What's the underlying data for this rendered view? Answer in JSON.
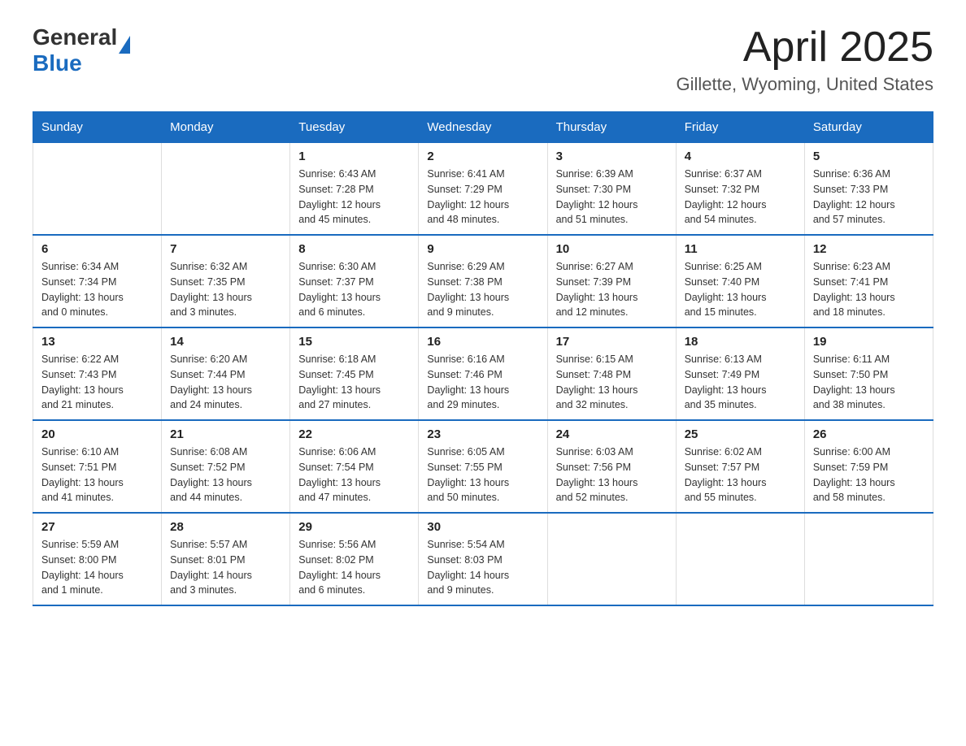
{
  "logo": {
    "general": "General",
    "blue": "Blue"
  },
  "title": "April 2025",
  "location": "Gillette, Wyoming, United States",
  "days_of_week": [
    "Sunday",
    "Monday",
    "Tuesday",
    "Wednesday",
    "Thursday",
    "Friday",
    "Saturday"
  ],
  "weeks": [
    [
      {
        "day": "",
        "info": ""
      },
      {
        "day": "",
        "info": ""
      },
      {
        "day": "1",
        "info": "Sunrise: 6:43 AM\nSunset: 7:28 PM\nDaylight: 12 hours\nand 45 minutes."
      },
      {
        "day": "2",
        "info": "Sunrise: 6:41 AM\nSunset: 7:29 PM\nDaylight: 12 hours\nand 48 minutes."
      },
      {
        "day": "3",
        "info": "Sunrise: 6:39 AM\nSunset: 7:30 PM\nDaylight: 12 hours\nand 51 minutes."
      },
      {
        "day": "4",
        "info": "Sunrise: 6:37 AM\nSunset: 7:32 PM\nDaylight: 12 hours\nand 54 minutes."
      },
      {
        "day": "5",
        "info": "Sunrise: 6:36 AM\nSunset: 7:33 PM\nDaylight: 12 hours\nand 57 minutes."
      }
    ],
    [
      {
        "day": "6",
        "info": "Sunrise: 6:34 AM\nSunset: 7:34 PM\nDaylight: 13 hours\nand 0 minutes."
      },
      {
        "day": "7",
        "info": "Sunrise: 6:32 AM\nSunset: 7:35 PM\nDaylight: 13 hours\nand 3 minutes."
      },
      {
        "day": "8",
        "info": "Sunrise: 6:30 AM\nSunset: 7:37 PM\nDaylight: 13 hours\nand 6 minutes."
      },
      {
        "day": "9",
        "info": "Sunrise: 6:29 AM\nSunset: 7:38 PM\nDaylight: 13 hours\nand 9 minutes."
      },
      {
        "day": "10",
        "info": "Sunrise: 6:27 AM\nSunset: 7:39 PM\nDaylight: 13 hours\nand 12 minutes."
      },
      {
        "day": "11",
        "info": "Sunrise: 6:25 AM\nSunset: 7:40 PM\nDaylight: 13 hours\nand 15 minutes."
      },
      {
        "day": "12",
        "info": "Sunrise: 6:23 AM\nSunset: 7:41 PM\nDaylight: 13 hours\nand 18 minutes."
      }
    ],
    [
      {
        "day": "13",
        "info": "Sunrise: 6:22 AM\nSunset: 7:43 PM\nDaylight: 13 hours\nand 21 minutes."
      },
      {
        "day": "14",
        "info": "Sunrise: 6:20 AM\nSunset: 7:44 PM\nDaylight: 13 hours\nand 24 minutes."
      },
      {
        "day": "15",
        "info": "Sunrise: 6:18 AM\nSunset: 7:45 PM\nDaylight: 13 hours\nand 27 minutes."
      },
      {
        "day": "16",
        "info": "Sunrise: 6:16 AM\nSunset: 7:46 PM\nDaylight: 13 hours\nand 29 minutes."
      },
      {
        "day": "17",
        "info": "Sunrise: 6:15 AM\nSunset: 7:48 PM\nDaylight: 13 hours\nand 32 minutes."
      },
      {
        "day": "18",
        "info": "Sunrise: 6:13 AM\nSunset: 7:49 PM\nDaylight: 13 hours\nand 35 minutes."
      },
      {
        "day": "19",
        "info": "Sunrise: 6:11 AM\nSunset: 7:50 PM\nDaylight: 13 hours\nand 38 minutes."
      }
    ],
    [
      {
        "day": "20",
        "info": "Sunrise: 6:10 AM\nSunset: 7:51 PM\nDaylight: 13 hours\nand 41 minutes."
      },
      {
        "day": "21",
        "info": "Sunrise: 6:08 AM\nSunset: 7:52 PM\nDaylight: 13 hours\nand 44 minutes."
      },
      {
        "day": "22",
        "info": "Sunrise: 6:06 AM\nSunset: 7:54 PM\nDaylight: 13 hours\nand 47 minutes."
      },
      {
        "day": "23",
        "info": "Sunrise: 6:05 AM\nSunset: 7:55 PM\nDaylight: 13 hours\nand 50 minutes."
      },
      {
        "day": "24",
        "info": "Sunrise: 6:03 AM\nSunset: 7:56 PM\nDaylight: 13 hours\nand 52 minutes."
      },
      {
        "day": "25",
        "info": "Sunrise: 6:02 AM\nSunset: 7:57 PM\nDaylight: 13 hours\nand 55 minutes."
      },
      {
        "day": "26",
        "info": "Sunrise: 6:00 AM\nSunset: 7:59 PM\nDaylight: 13 hours\nand 58 minutes."
      }
    ],
    [
      {
        "day": "27",
        "info": "Sunrise: 5:59 AM\nSunset: 8:00 PM\nDaylight: 14 hours\nand 1 minute."
      },
      {
        "day": "28",
        "info": "Sunrise: 5:57 AM\nSunset: 8:01 PM\nDaylight: 14 hours\nand 3 minutes."
      },
      {
        "day": "29",
        "info": "Sunrise: 5:56 AM\nSunset: 8:02 PM\nDaylight: 14 hours\nand 6 minutes."
      },
      {
        "day": "30",
        "info": "Sunrise: 5:54 AM\nSunset: 8:03 PM\nDaylight: 14 hours\nand 9 minutes."
      },
      {
        "day": "",
        "info": ""
      },
      {
        "day": "",
        "info": ""
      },
      {
        "day": "",
        "info": ""
      }
    ]
  ]
}
